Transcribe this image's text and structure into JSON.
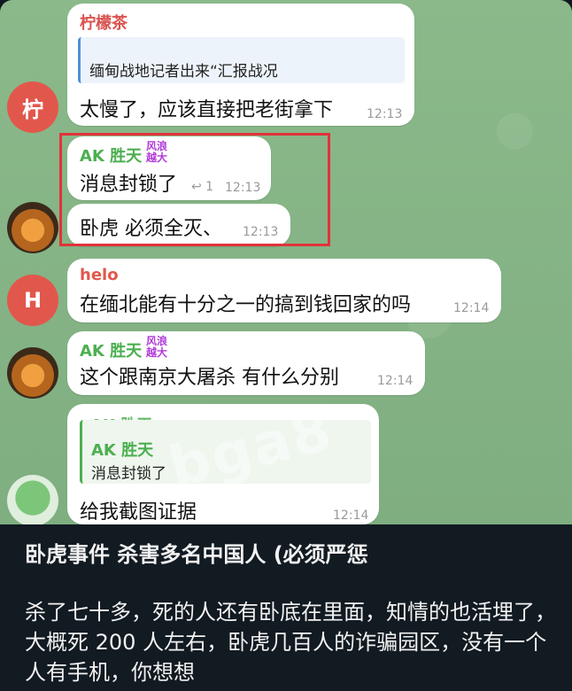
{
  "messages": [
    {
      "sender": "柠檬茶",
      "sender_color": "#d9534f",
      "quote_text": "缅甸战地记者出来“汇报战况",
      "text": "太慢了，应该直接把老街拿下",
      "time": "12:13",
      "avatar_letter": "柠",
      "avatar_color": "#e2574c"
    },
    {
      "sender": "AK 胜天",
      "sender_color": "#4caf50",
      "badge": "风浪越大",
      "text": "消息封锁了",
      "time": "12:13",
      "reply_icon": "↩ 1"
    },
    {
      "text": "卧虎  必须全灭、",
      "time": "12:13"
    },
    {
      "sender": "helo",
      "sender_color": "#e2574c",
      "text": "在缅北能有十分之一的搞到钱回家的吗",
      "time": "12:14",
      "avatar_letter": "H",
      "avatar_color": "#e2574c"
    },
    {
      "sender": "AK 胜天",
      "sender_color": "#4caf50",
      "badge": "风浪越大",
      "text": "这个跟南京大屠杀  有什么分别",
      "time": "12:14"
    },
    {
      "sender_fragment": "AK 胜天",
      "quote_sender": "AK 胜天",
      "quote_text": "消息封锁了",
      "text": "给我截图证据",
      "time": "12:14"
    }
  ],
  "watermark": "bga8",
  "caption": {
    "title": "卧虎事件 杀害多名中国人 (必须严惩",
    "body": "杀了七十多，死的人还有卧底在里面，知情的也活埋了，大概死 200 人左右，卧虎几百人的诈骗园区，没有一个人有手机，你想想"
  }
}
